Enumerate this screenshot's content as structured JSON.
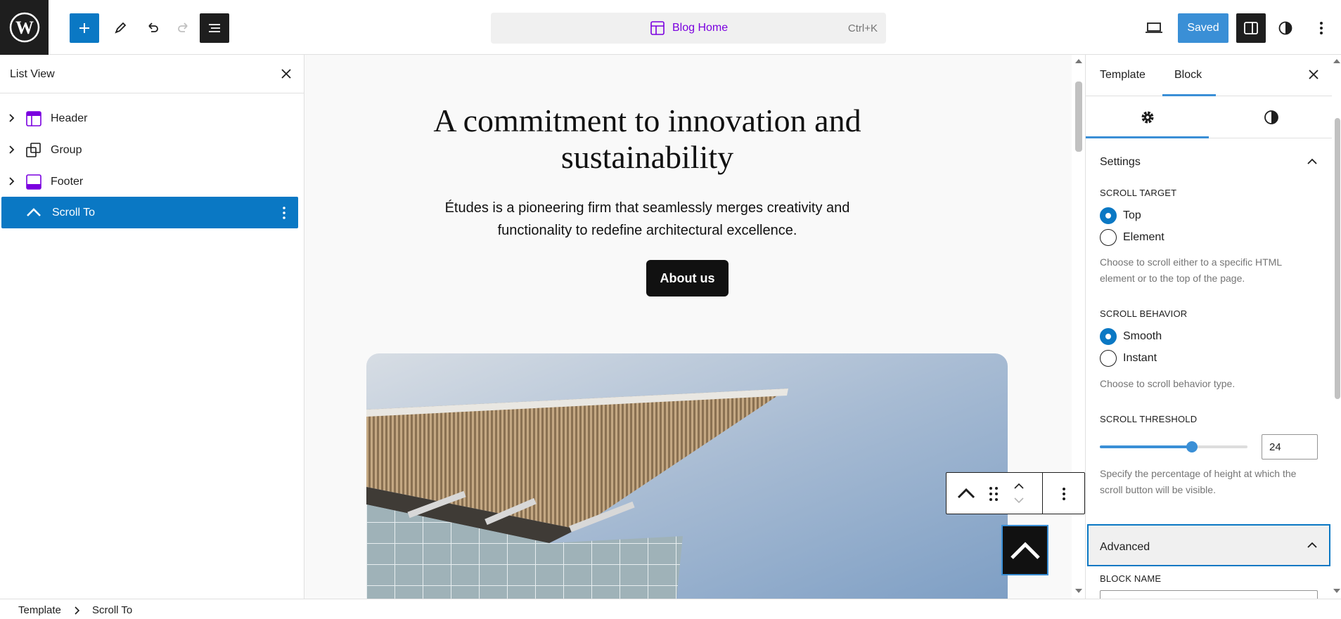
{
  "topbar": {
    "command_title": "Blog Home",
    "command_shortcut": "Ctrl+K",
    "saved_label": "Saved"
  },
  "listview": {
    "title": "List View",
    "items": [
      {
        "label": "Header",
        "icon": "template-part-header-icon"
      },
      {
        "label": "Group",
        "icon": "group-icon"
      },
      {
        "label": "Footer",
        "icon": "template-part-footer-icon"
      },
      {
        "label": "Scroll To",
        "icon": "chevron-up-icon",
        "selected": true
      }
    ]
  },
  "canvas": {
    "heading": "A commitment to innovation and sustainability",
    "text": "Études is a pioneering firm that seamlessly merges creativity and functionality to redefine architectural excellence.",
    "button": "About us"
  },
  "sidebar": {
    "tabs": [
      "Template",
      "Block"
    ],
    "active_tab": "Block",
    "settings_title": "Settings",
    "scroll_target_label": "SCROLL TARGET",
    "scroll_target_options": [
      "Top",
      "Element"
    ],
    "scroll_target_selected": "Top",
    "scroll_target_help": "Choose to scroll either to a specific HTML element or to the top of the page.",
    "scroll_behavior_label": "SCROLL BEHAVIOR",
    "scroll_behavior_options": [
      "Smooth",
      "Instant"
    ],
    "scroll_behavior_selected": "Smooth",
    "scroll_behavior_help": "Choose to scroll behavior type.",
    "scroll_threshold_label": "SCROLL THRESHOLD",
    "scroll_threshold_value": "24",
    "scroll_threshold_help": "Specify the percentage of height at which the scroll button will be visible.",
    "advanced_title": "Advanced",
    "block_name_label": "BLOCK NAME"
  },
  "breadcrumb": [
    "Template",
    "Scroll To"
  ],
  "colors": {
    "accent": "#3a8fd6",
    "selected": "#0a78c4",
    "template_part": "#7a00df"
  }
}
